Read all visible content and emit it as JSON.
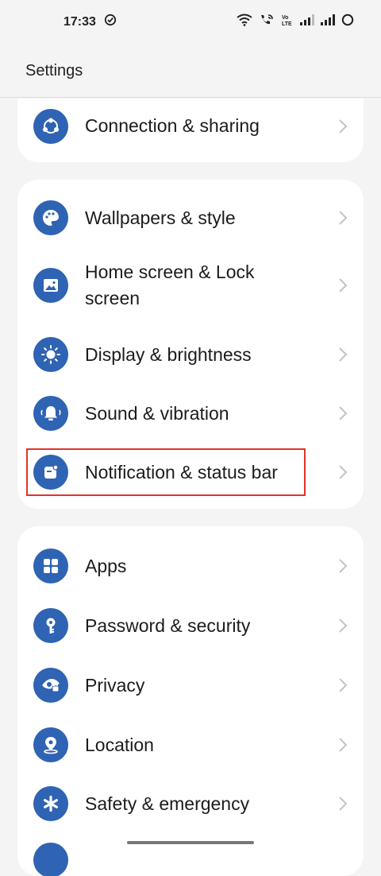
{
  "status_bar": {
    "time": "17:33",
    "volte_label": "Vo\nLTE"
  },
  "header": {
    "title": "Settings"
  },
  "groups": [
    {
      "items": [
        {
          "label": "Connection & sharing",
          "icon": "connection-icon"
        }
      ]
    },
    {
      "items": [
        {
          "label": "Wallpapers & style",
          "icon": "palette-icon"
        },
        {
          "label": "Home screen & Lock",
          "label2": "screen",
          "icon": "image-icon"
        },
        {
          "label": "Display & brightness",
          "icon": "sun-icon"
        },
        {
          "label": "Sound & vibration",
          "icon": "bell-icon"
        },
        {
          "label": "Notification & status bar",
          "icon": "notification-icon"
        }
      ]
    },
    {
      "items": [
        {
          "label": "Apps",
          "icon": "apps-grid-icon"
        },
        {
          "label": "Password & security",
          "icon": "key-icon"
        },
        {
          "label": "Privacy",
          "icon": "eye-lock-icon"
        },
        {
          "label": "Location",
          "icon": "location-icon"
        },
        {
          "label": "Safety & emergency",
          "icon": "asterisk-icon"
        }
      ]
    }
  ],
  "colors": {
    "icon_bg": "#2f63b3",
    "highlight": "#e2332a",
    "background": "#f4f4f4"
  }
}
